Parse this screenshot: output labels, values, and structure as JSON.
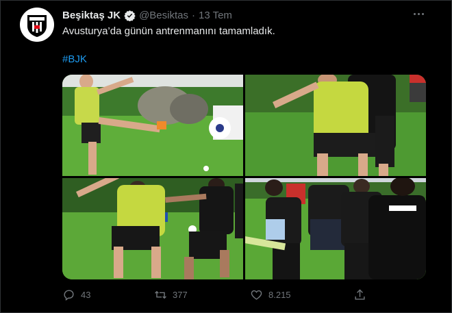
{
  "tweet": {
    "author_name": "Beşiktaş JK",
    "author_handle": "@Besiktas",
    "separator": "·",
    "timestamp": "13 Tem",
    "text": "Avusturya’da günün antrenmanını tamamladık.",
    "hashtag": "#BJK"
  },
  "avatar": {
    "label": "BJK",
    "year": "1903"
  },
  "media": {
    "photos": [
      {
        "kind": "player-kicking-ball"
      },
      {
        "kind": "player-in-training-bib"
      },
      {
        "kind": "two-players-challenging"
      },
      {
        "kind": "group-of-players"
      }
    ]
  },
  "actions": {
    "replies": "43",
    "retweets": "377",
    "likes": "8.215"
  },
  "colors": {
    "background": "#000000",
    "text": "#e7e9ea",
    "muted": "#71767b",
    "link": "#1d9bf0",
    "grass": "#5aa836"
  },
  "icons": {
    "verified": "verified-badge-icon",
    "more": "more-options-icon",
    "reply": "reply-icon",
    "retweet": "retweet-icon",
    "like": "heart-icon",
    "share": "share-icon"
  }
}
